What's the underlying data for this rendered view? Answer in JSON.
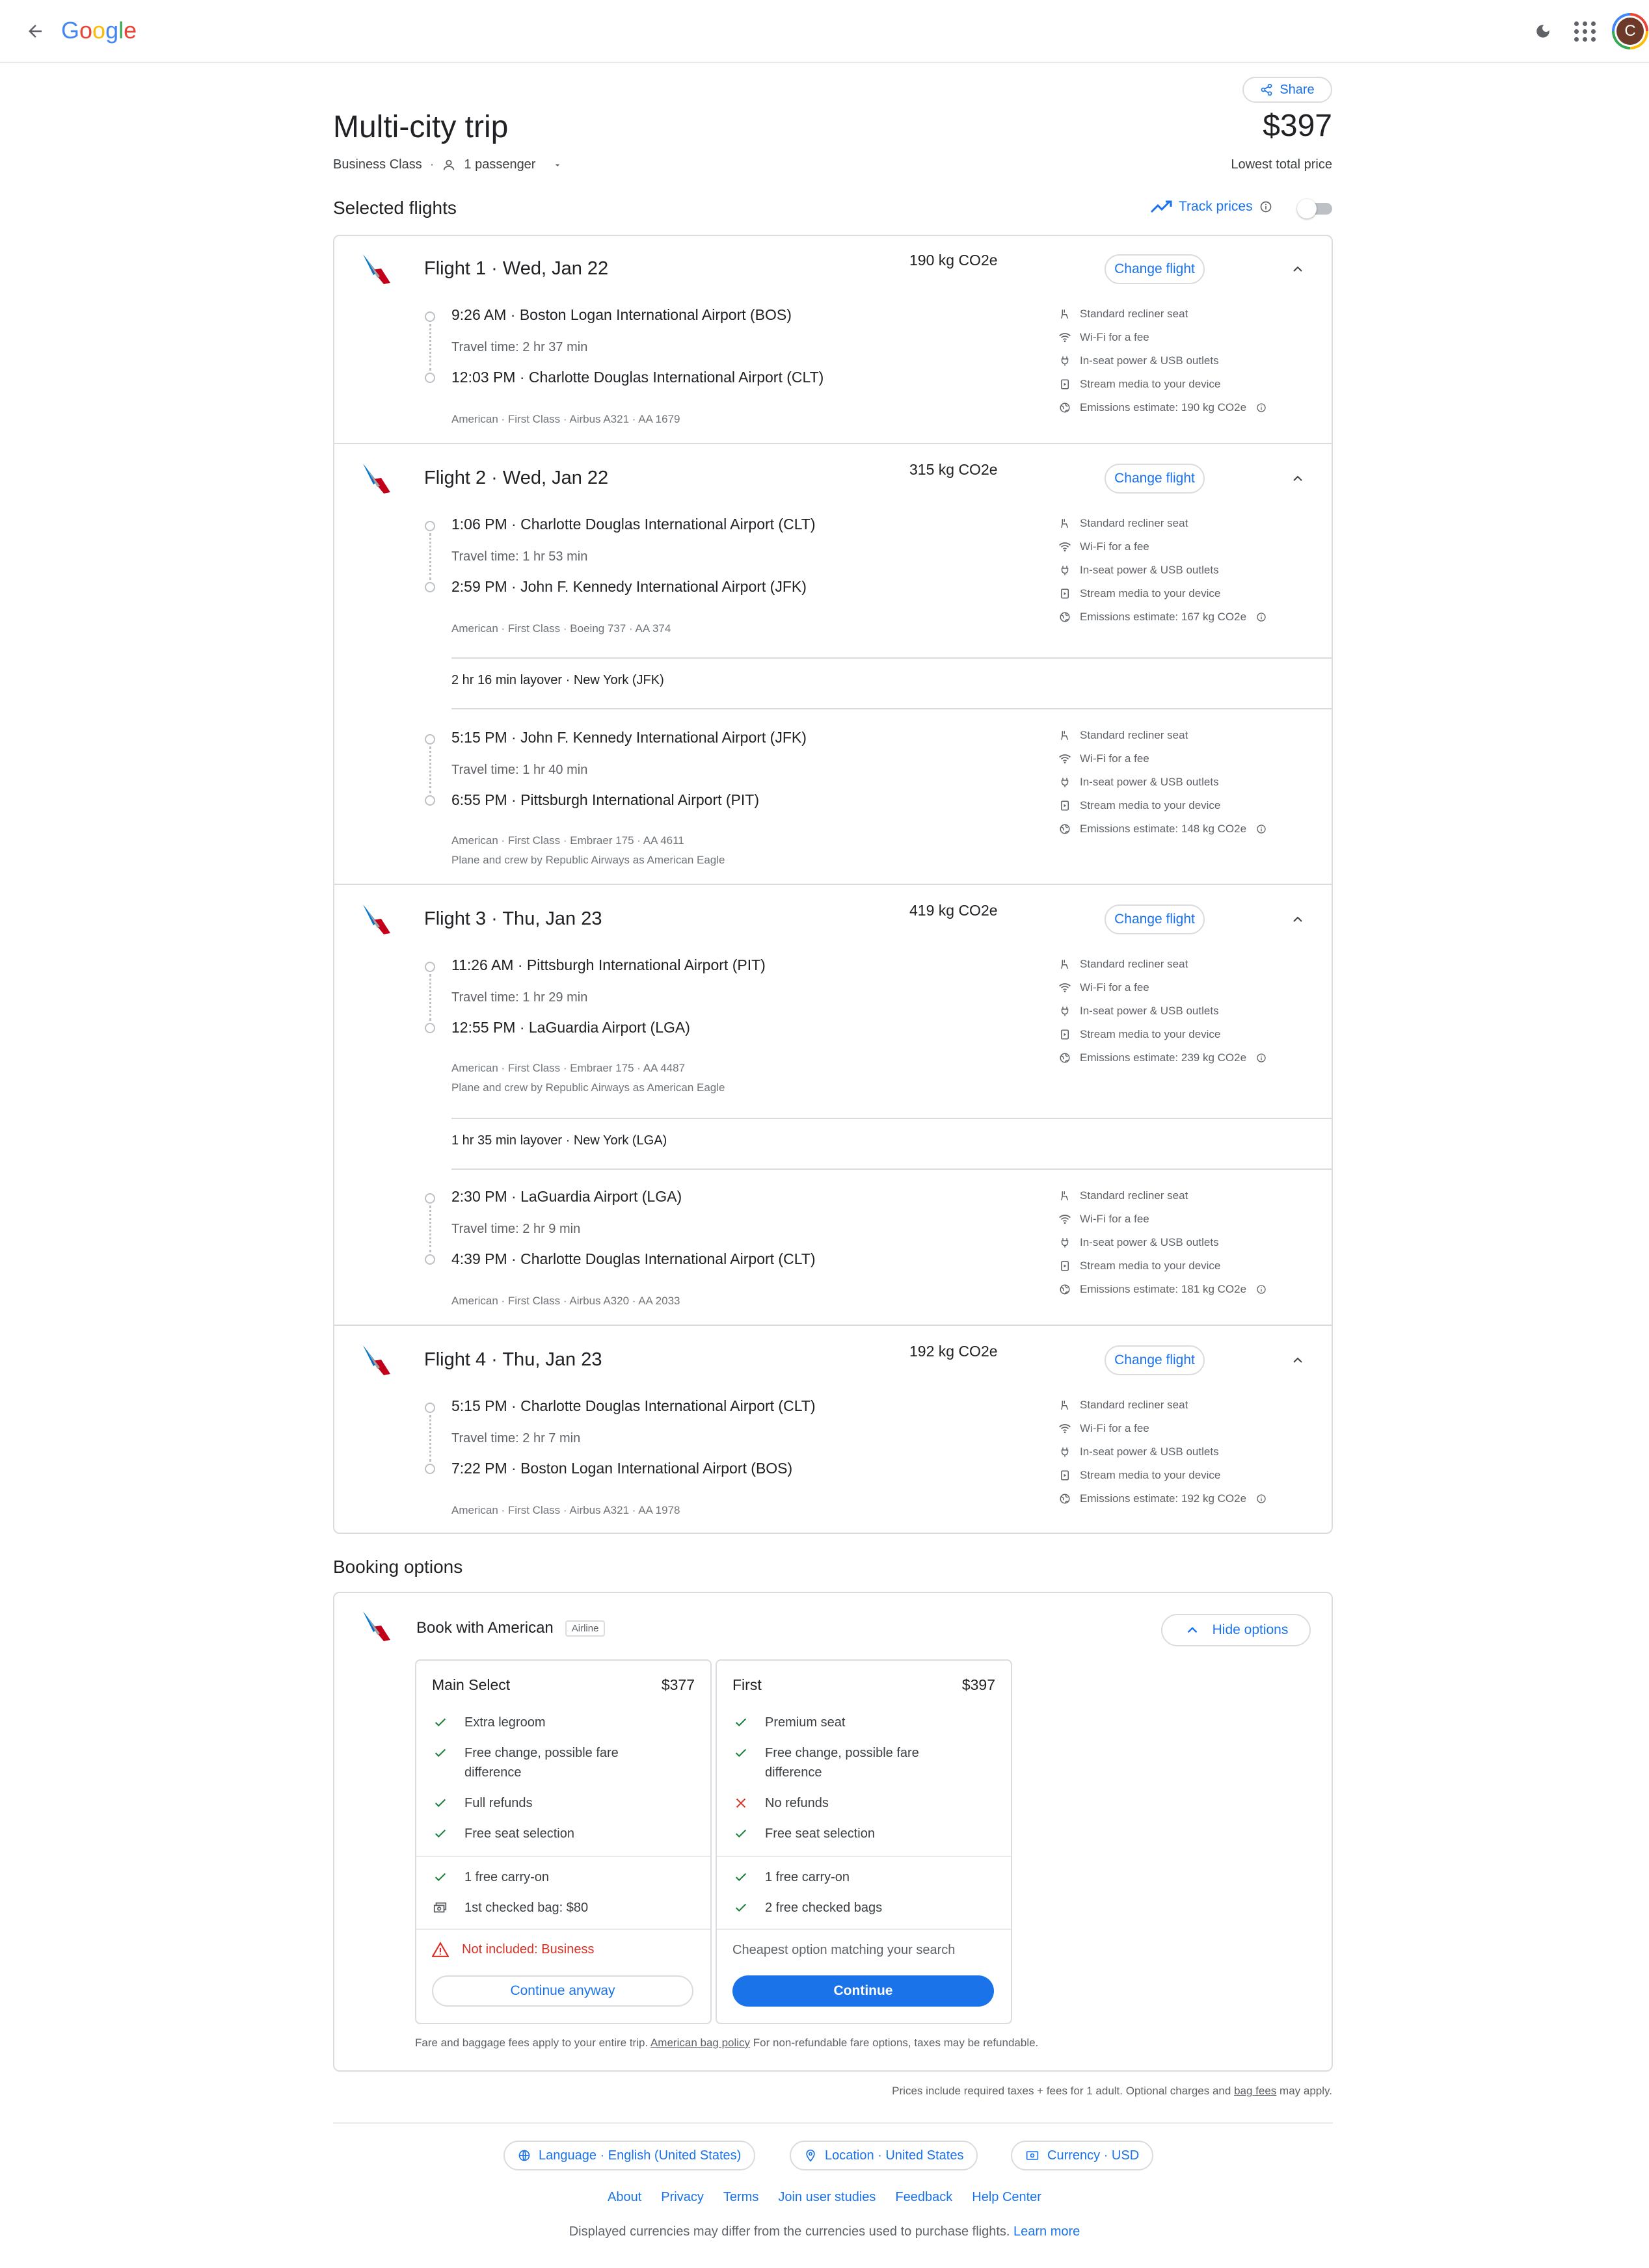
{
  "brand": {
    "logo_letters": [
      "G",
      "o",
      "o",
      "g",
      "l",
      "e"
    ]
  },
  "user": {
    "avatar_initial": "C"
  },
  "header": {
    "share_label": "Share",
    "title": "Multi-city trip",
    "price": "$397",
    "price_caption": "Lowest total price",
    "cabin": "Business Class",
    "passengers": "1 passenger"
  },
  "selected": {
    "title": "Selected flights",
    "track_label": "Track prices"
  },
  "change_label": "Change flight",
  "amenities_labels": {
    "seat": "Standard recliner seat",
    "wifi": "Wi-Fi for a fee",
    "power": "In-seat power & USB outlets",
    "stream": "Stream media to your device"
  },
  "flights": [
    {
      "heading": "Flight 1 · Wed, Jan 22",
      "co2": "190 kg CO2e",
      "segments": [
        {
          "dep": "9:26 AM  ·  Boston Logan International Airport (BOS)",
          "travel": "Travel time: 2 hr 37 min",
          "arr": "12:03 PM  ·  Charlotte Douglas International Airport (CLT)",
          "meta": "American · First Class · Airbus A321 · AA 1679",
          "meta2": "",
          "emissions": "Emissions estimate: 190 kg CO2e"
        }
      ]
    },
    {
      "heading": "Flight 2 · Wed, Jan 22",
      "co2": "315 kg CO2e",
      "layover": "2 hr 16 min layover · New York (JFK)",
      "segments": [
        {
          "dep": "1:06 PM  ·  Charlotte Douglas International Airport (CLT)",
          "travel": "Travel time: 1 hr 53 min",
          "arr": "2:59 PM  ·  John F. Kennedy International Airport (JFK)",
          "meta": "American · First Class · Boeing 737 · AA 374",
          "meta2": "",
          "emissions": "Emissions estimate: 167 kg CO2e"
        },
        {
          "dep": "5:15 PM  ·  John F. Kennedy International Airport (JFK)",
          "travel": "Travel time: 1 hr 40 min",
          "arr": "6:55 PM  ·  Pittsburgh International Airport (PIT)",
          "meta": "American · First Class · Embraer 175 · AA 4611",
          "meta2": "Plane and crew by Republic Airways as American Eagle",
          "emissions": "Emissions estimate: 148 kg CO2e"
        }
      ]
    },
    {
      "heading": "Flight 3 · Thu, Jan 23",
      "co2": "419 kg CO2e",
      "layover": "1 hr 35 min layover · New York (LGA)",
      "segments": [
        {
          "dep": "11:26 AM  ·  Pittsburgh International Airport (PIT)",
          "travel": "Travel time: 1 hr 29 min",
          "arr": "12:55 PM  ·  LaGuardia Airport (LGA)",
          "meta": "American · First Class · Embraer 175 · AA 4487",
          "meta2": "Plane and crew by Republic Airways as American Eagle",
          "emissions": "Emissions estimate: 239 kg CO2e"
        },
        {
          "dep": "2:30 PM  ·  LaGuardia Airport (LGA)",
          "travel": "Travel time: 2 hr 9 min",
          "arr": "4:39 PM  ·  Charlotte Douglas International Airport (CLT)",
          "meta": "American · First Class · Airbus A320 · AA 2033",
          "meta2": "",
          "emissions": "Emissions estimate: 181 kg CO2e"
        }
      ]
    },
    {
      "heading": "Flight 4 · Thu, Jan 23",
      "co2": "192 kg CO2e",
      "segments": [
        {
          "dep": "5:15 PM  ·  Charlotte Douglas International Airport (CLT)",
          "travel": "Travel time: 2 hr 7 min",
          "arr": "7:22 PM  ·  Boston Logan International Airport (BOS)",
          "meta": "American · First Class · Airbus A321 · AA 1978",
          "meta2": "",
          "emissions": "Emissions estimate: 192 kg CO2e"
        }
      ]
    }
  ],
  "booking": {
    "title": "Booking options",
    "book_with": "Book with American",
    "badge": "Airline",
    "hide_label": "Hide options",
    "fares": [
      {
        "name": "Main Select",
        "price": "$377",
        "items": [
          "Extra legroom",
          "Free change, possible fare difference",
          "Full refunds",
          "Free seat selection"
        ],
        "bags": [
          "1 free carry-on",
          "1st checked bag: $80"
        ],
        "warning": "Not included: Business",
        "button": "Continue anyway"
      },
      {
        "name": "First",
        "price": "$397",
        "items": [
          "Premium seat",
          "Free change, possible fare difference",
          "No refunds",
          "Free seat selection"
        ],
        "bags": [
          "1 free carry-on",
          "2 free checked bags"
        ],
        "note": "Cheapest option matching your search",
        "button": "Continue"
      }
    ],
    "foot_a": "Fare and baggage fees apply to your entire trip.",
    "foot_link": "American bag policy",
    "foot_b": "For non-refundable fare options, taxes may be refundable."
  },
  "prices_note": {
    "a": "Prices include required taxes + fees for 1 adult. Optional charges and",
    "link": "bag fees",
    "b": "may apply."
  },
  "footer": {
    "language": "Language · English (United States)",
    "location": "Location · United States",
    "currency": "Currency · USD",
    "links": [
      "About",
      "Privacy",
      "Terms",
      "Join user studies",
      "Feedback",
      "Help Center"
    ],
    "note": "Displayed currencies may differ from the currencies used to purchase flights.",
    "learn_more": "Learn more"
  },
  "colors": {
    "accent": "#1a73e8",
    "green": "#188038",
    "red": "#d93025",
    "border": "#dadce0"
  }
}
